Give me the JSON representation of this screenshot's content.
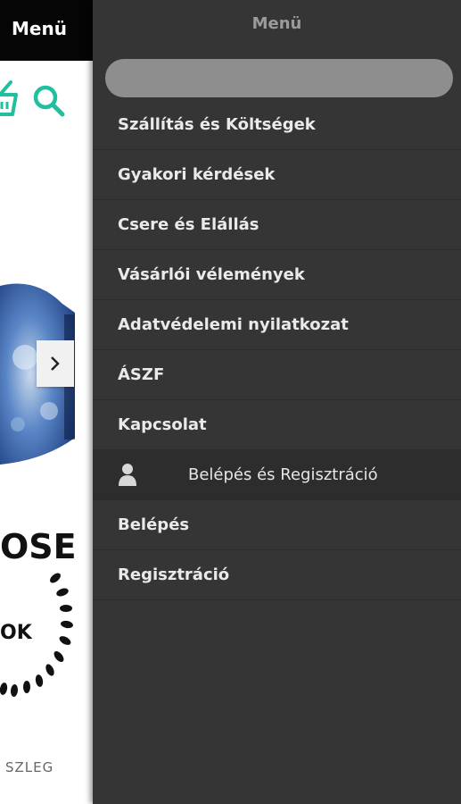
{
  "page": {
    "topbar_label": "Menü",
    "logo_sub": "SZLEG"
  },
  "menu": {
    "title": "Menü",
    "search_placeholder": "",
    "items": [
      {
        "label": "Szállítás és Költségek"
      },
      {
        "label": "Gyakori kérdések"
      },
      {
        "label": "Csere és Elállás"
      },
      {
        "label": "Vásárlói vélemények"
      },
      {
        "label": "Adatvédelemi nyilatkozat"
      },
      {
        "label": "ÁSZF"
      },
      {
        "label": "Kapcsolat"
      }
    ],
    "account_section": {
      "label": "Belépés és Regisztráció",
      "icon": "user-icon"
    },
    "account_items": [
      {
        "label": "Belépés"
      },
      {
        "label": "Regisztráció"
      }
    ]
  },
  "colors": {
    "menu_bg": "#353535",
    "accent": "#1fbf9f",
    "topbar": "#050505"
  }
}
